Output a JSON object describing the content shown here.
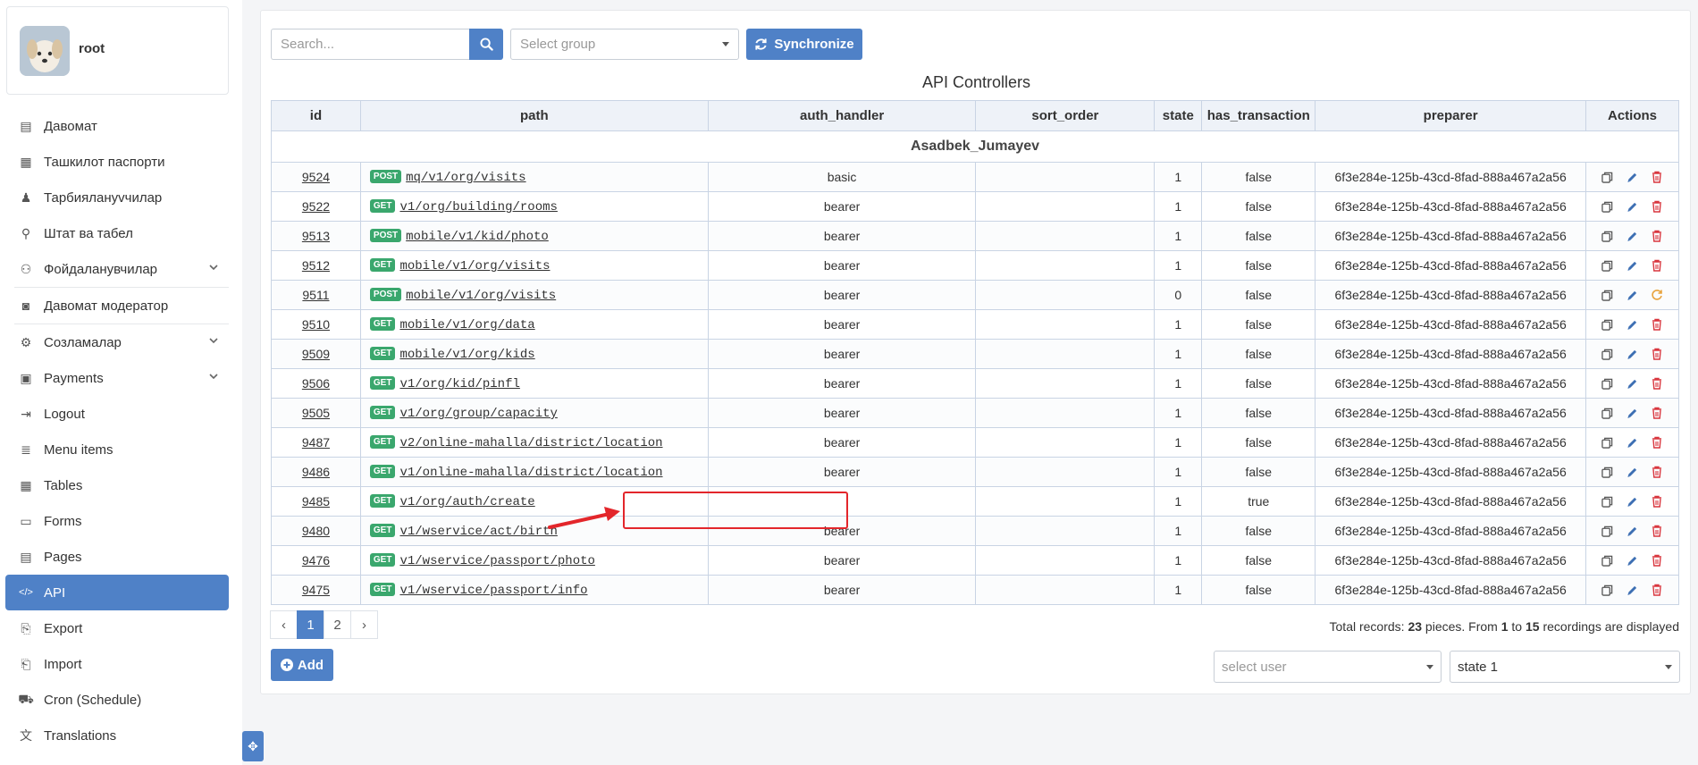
{
  "user": {
    "name": "root"
  },
  "sidebar": {
    "items": [
      {
        "label": "Давомат",
        "icon": "id-card-icon",
        "chevron": false
      },
      {
        "label": "Ташкилот паспорти",
        "icon": "building-icon",
        "chevron": false
      },
      {
        "label": "Тарбиялануvчилар",
        "icon": "child-icon",
        "chevron": false
      },
      {
        "label": "Штат ва табел",
        "icon": "person-tree-icon",
        "chevron": false
      },
      {
        "label": "Фойдаланувчилар",
        "icon": "users-gear-icon",
        "chevron": true
      },
      {
        "label": "Давомат модератор",
        "icon": "camera-icon",
        "chevron": false
      },
      {
        "label": "Созламалар",
        "icon": "gears-icon",
        "chevron": true
      },
      {
        "label": "Payments",
        "icon": "money-icon",
        "chevron": true
      },
      {
        "label": "Logout",
        "icon": "logout-icon",
        "chevron": false
      },
      {
        "label": "Menu items",
        "icon": "list-icon",
        "chevron": false
      },
      {
        "label": "Tables",
        "icon": "table-icon",
        "chevron": false
      },
      {
        "label": "Forms",
        "icon": "forms-icon",
        "chevron": false
      },
      {
        "label": "Pages",
        "icon": "pages-icon",
        "chevron": false
      },
      {
        "label": "API",
        "icon": "code-icon",
        "chevron": false,
        "active": true
      },
      {
        "label": "Export",
        "icon": "export-icon",
        "chevron": false
      },
      {
        "label": "Import",
        "icon": "import-icon",
        "chevron": false
      },
      {
        "label": "Cron (Schedule)",
        "icon": "truck-clock-icon",
        "chevron": false
      },
      {
        "label": "Translations",
        "icon": "translate-icon",
        "chevron": false
      }
    ]
  },
  "toolbar": {
    "search_placeholder": "Search...",
    "group_placeholder": "Select group",
    "sync_label": "Synchronize"
  },
  "table": {
    "title": "API Controllers",
    "columns": [
      "id",
      "path",
      "auth_handler",
      "sort_order",
      "state",
      "has_transaction",
      "preparer",
      "Actions"
    ],
    "group_name": "Asadbek_Jumayev",
    "rows": [
      {
        "id": "9524",
        "method": "POST",
        "path": "mq/v1/org/visits",
        "auth": "basic",
        "sort": "",
        "state": "1",
        "tx": "false",
        "preparer": "6f3e284e-125b-43cd-8fad-888a467a2a56",
        "restore": false
      },
      {
        "id": "9522",
        "method": "GET",
        "path": "v1/org/building/rooms",
        "auth": "bearer",
        "sort": "",
        "state": "1",
        "tx": "false",
        "preparer": "6f3e284e-125b-43cd-8fad-888a467a2a56",
        "restore": false
      },
      {
        "id": "9513",
        "method": "POST",
        "path": "mobile/v1/kid/photo",
        "auth": "bearer",
        "sort": "",
        "state": "1",
        "tx": "false",
        "preparer": "6f3e284e-125b-43cd-8fad-888a467a2a56",
        "restore": false
      },
      {
        "id": "9512",
        "method": "GET",
        "path": "mobile/v1/org/visits",
        "auth": "bearer",
        "sort": "",
        "state": "1",
        "tx": "false",
        "preparer": "6f3e284e-125b-43cd-8fad-888a467a2a56",
        "restore": false
      },
      {
        "id": "9511",
        "method": "POST",
        "path": "mobile/v1/org/visits",
        "auth": "bearer",
        "sort": "",
        "state": "0",
        "tx": "false",
        "preparer": "6f3e284e-125b-43cd-8fad-888a467a2a56",
        "restore": true
      },
      {
        "id": "9510",
        "method": "GET",
        "path": "mobile/v1/org/data",
        "auth": "bearer",
        "sort": "",
        "state": "1",
        "tx": "false",
        "preparer": "6f3e284e-125b-43cd-8fad-888a467a2a56",
        "restore": false
      },
      {
        "id": "9509",
        "method": "GET",
        "path": "mobile/v1/org/kids",
        "auth": "bearer",
        "sort": "",
        "state": "1",
        "tx": "false",
        "preparer": "6f3e284e-125b-43cd-8fad-888a467a2a56",
        "restore": false
      },
      {
        "id": "9506",
        "method": "GET",
        "path": "v1/org/kid/pinfl",
        "auth": "bearer",
        "sort": "",
        "state": "1",
        "tx": "false",
        "preparer": "6f3e284e-125b-43cd-8fad-888a467a2a56",
        "restore": false
      },
      {
        "id": "9505",
        "method": "GET",
        "path": "v1/org/group/capacity",
        "auth": "bearer",
        "sort": "",
        "state": "1",
        "tx": "false",
        "preparer": "6f3e284e-125b-43cd-8fad-888a467a2a56",
        "restore": false
      },
      {
        "id": "9487",
        "method": "GET",
        "path": "v2/online-mahalla/district/location",
        "auth": "bearer",
        "sort": "",
        "state": "1",
        "tx": "false",
        "preparer": "6f3e284e-125b-43cd-8fad-888a467a2a56",
        "restore": false
      },
      {
        "id": "9486",
        "method": "GET",
        "path": "v1/online-mahalla/district/location",
        "auth": "bearer",
        "sort": "",
        "state": "1",
        "tx": "false",
        "preparer": "6f3e284e-125b-43cd-8fad-888a467a2a56",
        "restore": false
      },
      {
        "id": "9485",
        "method": "GET",
        "path": "v1/org/auth/create",
        "auth": "",
        "sort": "",
        "state": "1",
        "tx": "true",
        "preparer": "6f3e284e-125b-43cd-8fad-888a467a2a56",
        "restore": false
      },
      {
        "id": "9480",
        "method": "GET",
        "path": "v1/wservice/act/birth",
        "auth": "bearer",
        "sort": "",
        "state": "1",
        "tx": "false",
        "preparer": "6f3e284e-125b-43cd-8fad-888a467a2a56",
        "restore": false
      },
      {
        "id": "9476",
        "method": "GET",
        "path": "v1/wservice/passport/photo",
        "auth": "bearer",
        "sort": "",
        "state": "1",
        "tx": "false",
        "preparer": "6f3e284e-125b-43cd-8fad-888a467a2a56",
        "restore": false
      },
      {
        "id": "9475",
        "method": "GET",
        "path": "v1/wservice/passport/info",
        "auth": "bearer",
        "sort": "",
        "state": "1",
        "tx": "false",
        "preparer": "6f3e284e-125b-43cd-8fad-888a467a2a56",
        "restore": false
      }
    ]
  },
  "pagination": {
    "prev": "‹",
    "pages": [
      "1",
      "2"
    ],
    "current": "1",
    "next": "›"
  },
  "totals": {
    "prefix": "Total records: ",
    "total": "23",
    "mid": " pieces. From ",
    "from": "1",
    "to_word": " to ",
    "to": "15",
    "suffix": " recordings are displayed"
  },
  "footer": {
    "add_label": "Add",
    "user_placeholder": "select user",
    "state_value": "state 1"
  },
  "colors": {
    "accent": "#4f81c7",
    "get_badge": "#3aa76d",
    "delete": "#d9363e",
    "restore": "#e8a33d",
    "highlight": "#e3262b"
  }
}
